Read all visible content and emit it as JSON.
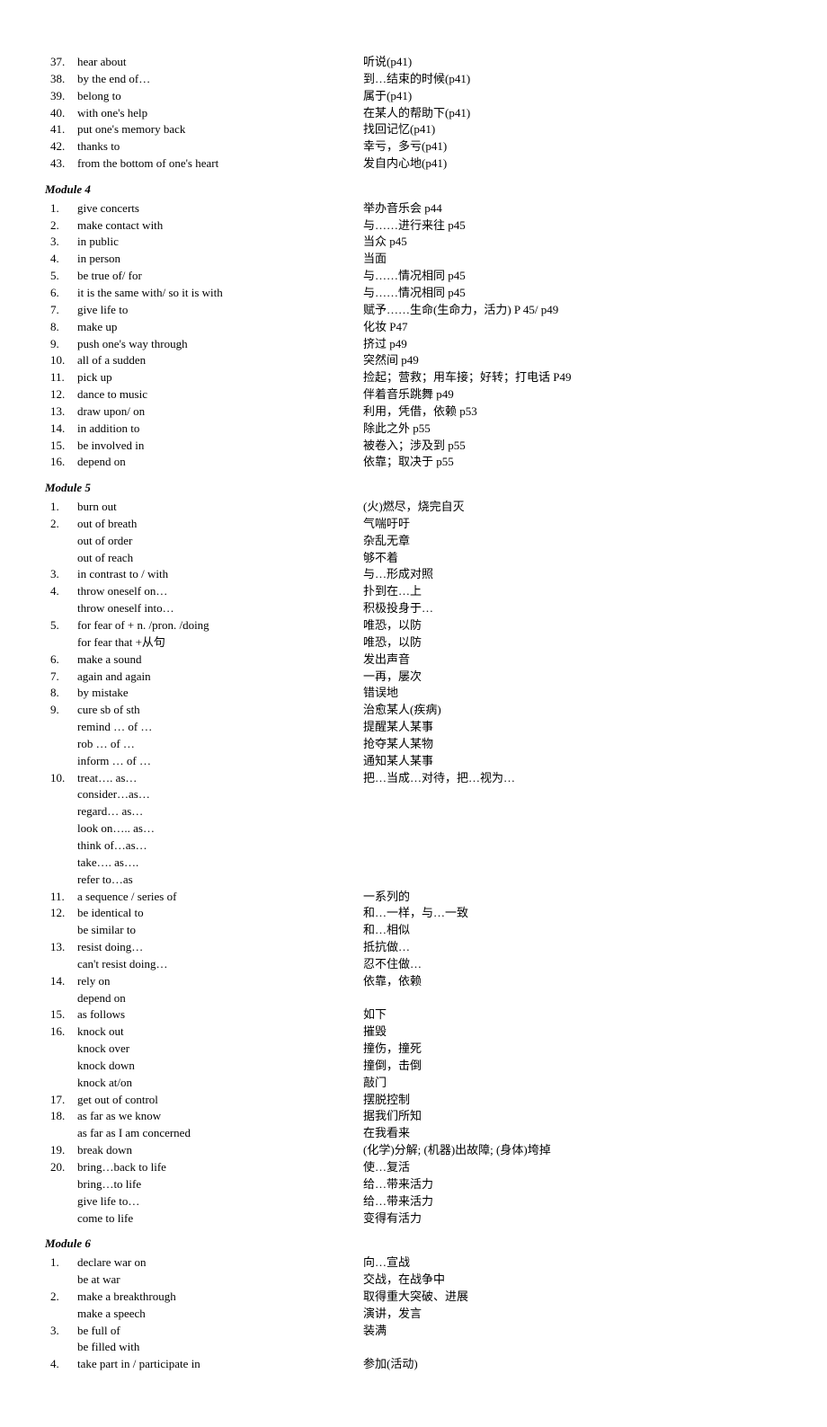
{
  "sections": [
    {
      "title": null,
      "items": [
        {
          "n": "37.",
          "en": "hear about",
          "cn": "听说(p41)"
        },
        {
          "n": "38.",
          "en": "by the end of…",
          "cn": "到…结束的时候(p41)"
        },
        {
          "n": "39.",
          "en": "belong to",
          "cn": "属于(p41)"
        },
        {
          "n": "40.",
          "en": "with one's help",
          "cn": "在某人的帮助下(p41)"
        },
        {
          "n": "41.",
          "en": "put one's memory back",
          "cn": "找回记忆(p41)"
        },
        {
          "n": "42.",
          "en": "thanks to",
          "cn": "幸亏，多亏(p41)"
        },
        {
          "n": "43.",
          "en": "from the bottom of one's heart",
          "cn": "发自内心地(p41)"
        }
      ]
    },
    {
      "title": "Module 4",
      "items": [
        {
          "n": "1.",
          "en": "give concerts",
          "cn": "举办音乐会 p44"
        },
        {
          "n": "2.",
          "en": "make contact with",
          "cn": "与……进行来往 p45"
        },
        {
          "n": "3.",
          "en": "in public",
          "cn": "当众 p45"
        },
        {
          "n": "4.",
          "en": "in person",
          "cn": "当面"
        },
        {
          "n": "5.",
          "en": "be true of/ for",
          "cn": "与……情况相同 p45"
        },
        {
          "n": "6.",
          "en": "it is the same with/ so it is with",
          "cn": "与……情况相同 p45"
        },
        {
          "n": "7.",
          "en": "give life to",
          "cn": "赋予……生命(生命力，活力) P 45/ p49"
        },
        {
          "n": "8.",
          "en": "make up",
          "cn": "化妆  P47"
        },
        {
          "n": "9.",
          "en": "push one's way through",
          "cn": "挤过 p49"
        },
        {
          "n": "10.",
          "en": "all of a sudden",
          "cn": "突然间 p49"
        },
        {
          "n": "11.",
          "en": "pick up",
          "cn": "捡起；营救；用车接；好转；打电话 P49"
        },
        {
          "n": "12.",
          "en": "dance to music",
          "cn": "伴着音乐跳舞 p49"
        },
        {
          "n": "13.",
          "en": "draw upon/ on",
          "cn": "利用，凭借，依赖  p53"
        },
        {
          "n": "14.",
          "en": "in addition to",
          "cn": "除此之外 p55"
        },
        {
          "n": "15.",
          "en": "be involved in",
          "cn": "被卷入；涉及到 p55"
        },
        {
          "n": "16.",
          "en": "depend on",
          "cn": "依靠；取决于 p55"
        }
      ]
    },
    {
      "title": "Module 5",
      "items": [
        {
          "n": "1.",
          "en": "burn out",
          "cn": "(火)燃尽，烧完自灭"
        },
        {
          "n": "2.",
          "en": "out of breath",
          "cn": "气喘吁吁"
        },
        {
          "n": "",
          "en": "out of order",
          "cn": "杂乱无章"
        },
        {
          "n": "",
          "en": "out of reach",
          "cn": "够不着"
        },
        {
          "n": "3.",
          "en": "in contrast to / with",
          "cn": "与…形成对照"
        },
        {
          "n": "4.",
          "en": "throw oneself on…",
          "cn": "扑到在…上"
        },
        {
          "n": "",
          "en": "throw oneself into…",
          "cn": "积极投身于…"
        },
        {
          "n": "5.",
          "en": "for fear of + n. /pron. /doing",
          "cn": "唯恐，以防"
        },
        {
          "n": "",
          "en": "for fear that +从句",
          "cn": "唯恐，以防"
        },
        {
          "n": "6.",
          "en": "make a sound",
          "cn": "发出声音"
        },
        {
          "n": "7.",
          "en": "again and again",
          "cn": "一再，屡次"
        },
        {
          "n": "8.",
          "en": "by mistake",
          "cn": "错误地"
        },
        {
          "n": "9.",
          "en": "cure sb of sth",
          "cn": "治愈某人(疾病)"
        },
        {
          "n": "",
          "en": "remind … of …",
          "cn": "提醒某人某事"
        },
        {
          "n": "",
          "en": "rob … of …",
          "cn": "抢夺某人某物"
        },
        {
          "n": "",
          "en": "inform … of …",
          "cn": "通知某人某事"
        },
        {
          "n": "10.",
          "en": "treat…. as…",
          "cn": "把…当成…对待，把…视为…"
        },
        {
          "n": "",
          "en": "consider…as…",
          "cn": ""
        },
        {
          "n": "",
          "en": "regard… as…",
          "cn": ""
        },
        {
          "n": "",
          "en": "look on….. as…",
          "cn": ""
        },
        {
          "n": "",
          "en": "think of…as…",
          "cn": ""
        },
        {
          "n": "",
          "en": "take…. as….",
          "cn": ""
        },
        {
          "n": "",
          "en": "refer to…as",
          "cn": ""
        },
        {
          "n": "11.",
          "en": "a sequence / series of",
          "cn": "一系列的"
        },
        {
          "n": "12.",
          "en": "be identical to",
          "cn": "和…一样，与…一致"
        },
        {
          "n": "",
          "en": "be similar to",
          "cn": "和…相似"
        },
        {
          "n": "13.",
          "en": "resist doing…",
          "cn": "抵抗做…"
        },
        {
          "n": "",
          "en": "can't resist doing…",
          "cn": "忍不住做…"
        },
        {
          "n": "14.",
          "en": "rely on",
          "cn": "依靠，依赖"
        },
        {
          "n": "",
          "en": "depend on",
          "cn": ""
        },
        {
          "n": "15.",
          "en": "as follows",
          "cn": "如下"
        },
        {
          "n": "16.",
          "en": "knock out",
          "cn": "摧毁"
        },
        {
          "n": "",
          "en": "knock over",
          "cn": "撞伤，撞死"
        },
        {
          "n": "",
          "en": "knock down",
          "cn": "撞倒，击倒"
        },
        {
          "n": "",
          "en": "knock at/on",
          "cn": "敲门"
        },
        {
          "n": "17.",
          "en": "get out of control",
          "cn": "摆脱控制"
        },
        {
          "n": "18.",
          "en": "as far as we know",
          "cn": "据我们所知"
        },
        {
          "n": "",
          "en": "as far as I am concerned",
          "cn": "在我看来"
        },
        {
          "n": "19.",
          "en": "break down",
          "cn": "(化学)分解; (机器)出故障; (身体)垮掉"
        },
        {
          "n": "20.",
          "en": "bring…back to life",
          "cn": "使…复活"
        },
        {
          "n": "",
          "en": "bring…to life",
          "cn": "给…带来活力"
        },
        {
          "n": "",
          "en": "give life to…",
          "cn": "给…带来活力"
        },
        {
          "n": "",
          "en": "come to life",
          "cn": "变得有活力"
        }
      ]
    },
    {
      "title": "Module 6",
      "items": [
        {
          "n": "1.",
          "en": "declare war on",
          "cn": "向…宣战"
        },
        {
          "n": "",
          "en": "be at war",
          "cn": "交战，在战争中"
        },
        {
          "n": "2.",
          "en": "make a breakthrough",
          "cn": "取得重大突破、进展"
        },
        {
          "n": "",
          "en": "make a speech",
          "cn": "演讲，发言"
        },
        {
          "n": "3.",
          "en": "be full of",
          "cn": "装满"
        },
        {
          "n": "",
          "en": "be filled with",
          "cn": ""
        },
        {
          "n": "4.",
          "en": "take part in / participate in",
          "cn": "参加(活动)"
        }
      ]
    }
  ]
}
